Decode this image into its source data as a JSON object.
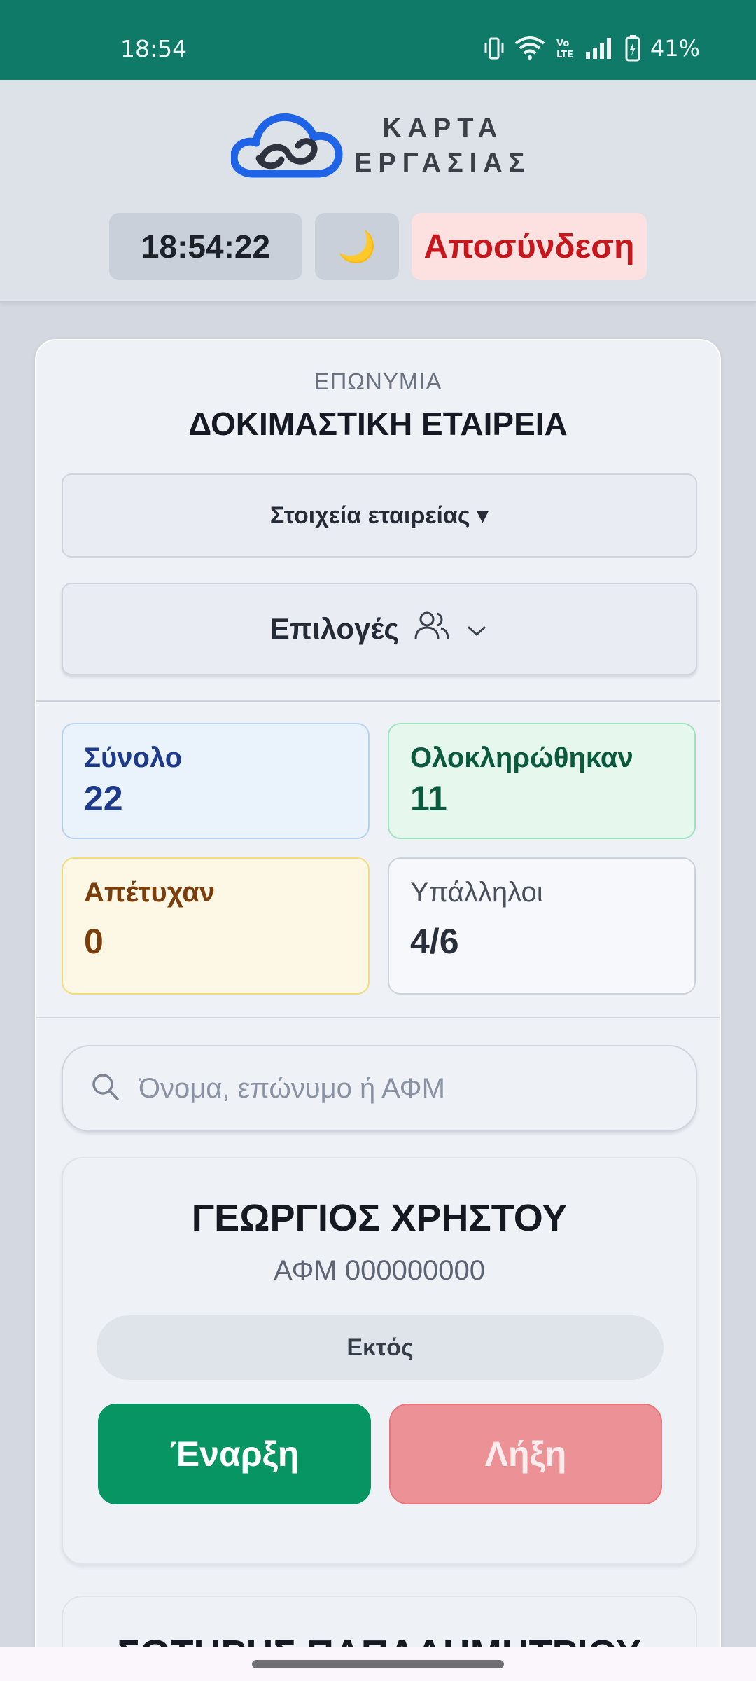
{
  "status_bar": {
    "time": "18:54",
    "battery": "41%",
    "icons": [
      "vibrate-icon",
      "wifi-icon",
      "volte-icon",
      "signal-icon",
      "battery-icon"
    ]
  },
  "header": {
    "logo_line1": "ΚΑΡΤΑ",
    "logo_line2": "ΕΡΓΑΣΙΑΣ",
    "clock": "18:54:22",
    "theme_icon": "🌙",
    "logout_label": "Αποσύνδεση"
  },
  "company": {
    "label": "ΕΠΩΝΥΜΙΑ",
    "name": "ΔΟΚΙΜΑΣΤΙΚΗ ΕΤΑΙΡΕΙΑ",
    "details_label": "Στοιχεία εταιρείας ▾",
    "options_label": "Επιλογές"
  },
  "stats": {
    "total_label": "Σύνολο",
    "total_value": "22",
    "done_label": "Ολοκληρώθηκαν",
    "done_value": "11",
    "failed_label": "Απέτυχαν",
    "failed_value": "0",
    "employees_label": "Υπάλληλοι",
    "employees_value": "4/6"
  },
  "search": {
    "placeholder": "Όνομα, επώνυμο ή ΑΦΜ"
  },
  "employees": [
    {
      "name": "ΓΕΩΡΓΙΟΣ ΧΡΗΣΤΟΥ",
      "afm": "ΑΦΜ 000000000",
      "status": "Εκτός",
      "start_label": "Έναρξη",
      "end_label": "Λήξη"
    },
    {
      "name": "ΣΩΤΗΡΗΣ ΠΑΠΑΔΗΜΗΤΡΙΟΥ"
    }
  ],
  "colors": {
    "status_bar": "#0f7a68",
    "start_button": "#069563",
    "end_button": "#ec9296",
    "logout_text": "#c8161d"
  }
}
